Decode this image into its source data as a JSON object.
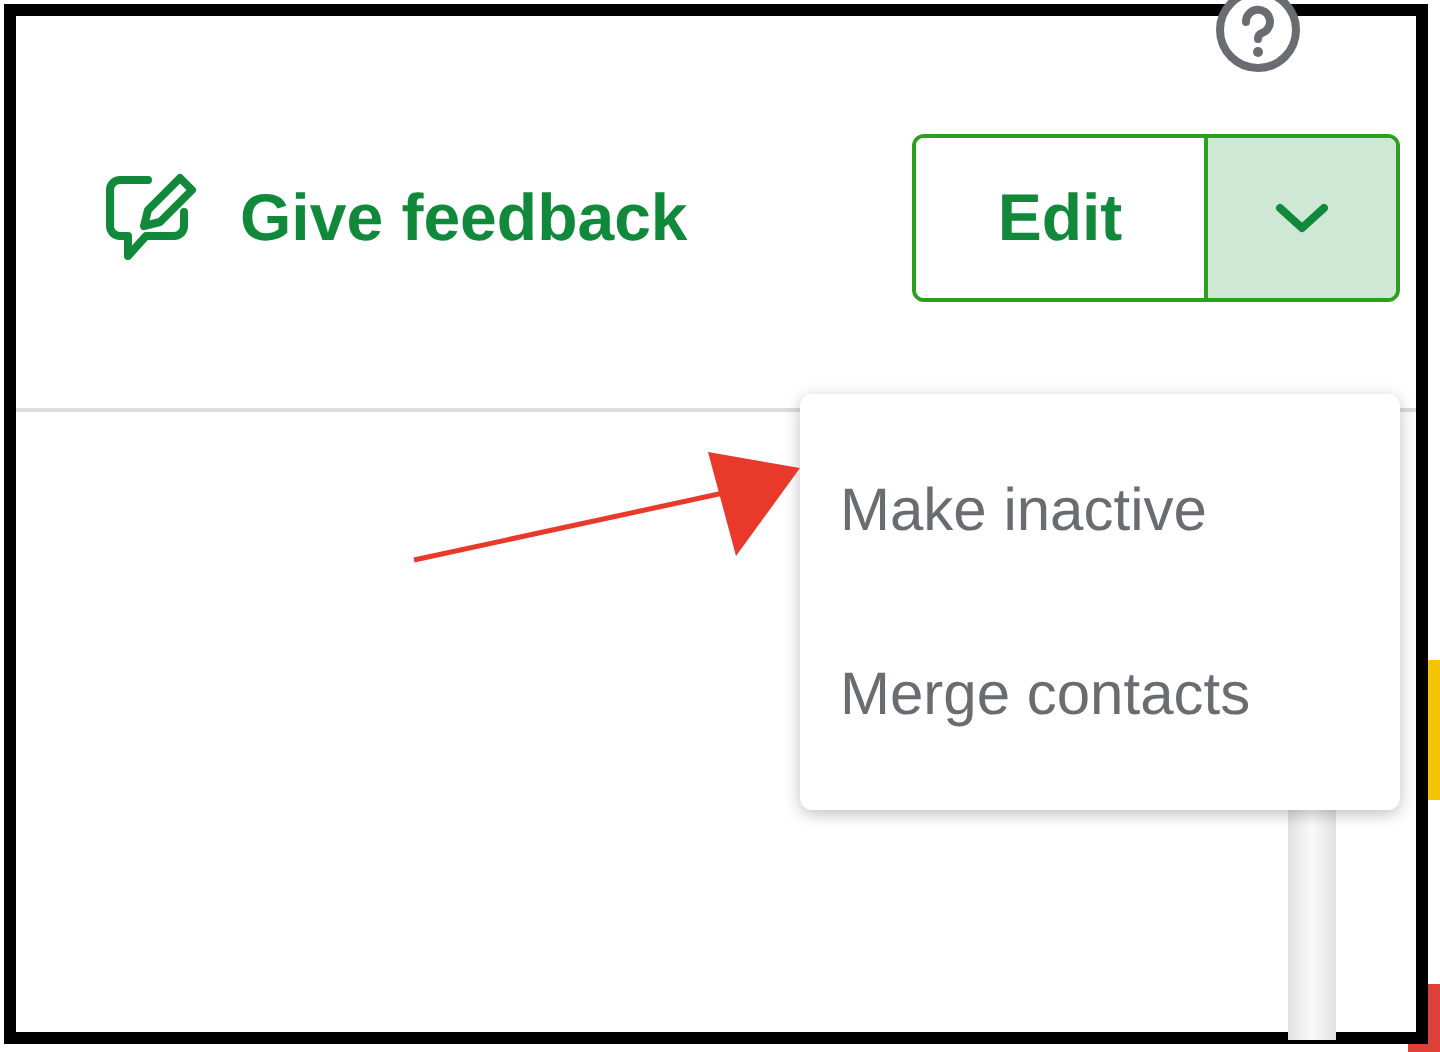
{
  "feedback_link": {
    "label": "Give feedback"
  },
  "edit_button": {
    "label": "Edit",
    "menu_expanded": true
  },
  "menu": {
    "items": [
      {
        "label": "Make inactive"
      },
      {
        "label": "Merge contacts"
      }
    ]
  }
}
